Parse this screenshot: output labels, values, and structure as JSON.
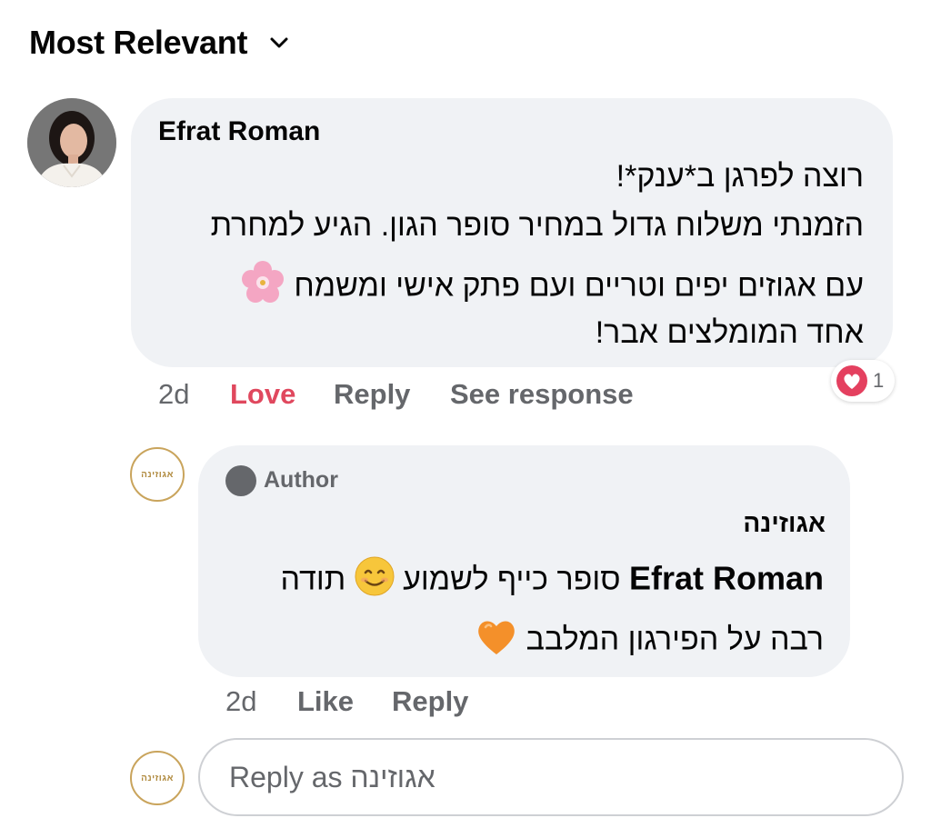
{
  "sort": {
    "label": "Most Relevant"
  },
  "comment": {
    "author": "Efrat Roman",
    "lines": [
      "רוצה לפרגן ב*ענק*!",
      "הזמנתי משלוח גדול במחיר סופר הגון. הגיע למחרת",
      "עם אגוזים יפים וטריים ועם פתק אישי ומשמח",
      "אחד המומלצים אבר!"
    ],
    "time": "2d",
    "love_label": "Love",
    "reply_label": "Reply",
    "see_response_label": "See response",
    "reaction_count": "1",
    "reaction_icon": "heart-love-icon",
    "emoji_line3": "cherry-blossom-icon"
  },
  "reply": {
    "author_badge": "Author",
    "author": "אגוזינה",
    "mention": "Efrat Roman",
    "line1_text": "סופר כייף לשמוע",
    "line1_tail": "תודה",
    "line2_text": "רבה על הפירגון המלבב",
    "emoji1": "smiling-face-icon",
    "emoji2": "orange-heart-icon",
    "time": "2d",
    "like_label": "Like",
    "reply_label": "Reply"
  },
  "page_logo": {
    "text": "אגוזינה"
  },
  "reply_box": {
    "placeholder": "Reply as אגוזינה"
  },
  "colors": {
    "bubble": "#f0f2f5",
    "meta": "#65676b",
    "love": "#e0485e",
    "logo_gold": "#c9a45c"
  }
}
